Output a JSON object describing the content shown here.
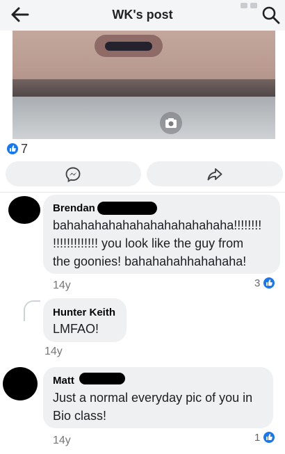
{
  "header": {
    "title": "WK's post"
  },
  "post": {
    "reaction_count": "7"
  },
  "comments": [
    {
      "author": "Brendan",
      "text": "bahahahahahahahahahahahaha!!!!!!!!\n!!!!!!!!!!!!! you look like the guy from\nthe goonies! bahahahahhahahaha!",
      "time": "14y",
      "reaction_count": "3"
    },
    {
      "author": "Hunter Keith",
      "text": "LMFAO!",
      "time": "14y"
    },
    {
      "author": "Matt",
      "text": "Just a normal everyday pic of you in\nBio class!",
      "time": "14y",
      "reaction_count": "1"
    }
  ],
  "colors": {
    "accent": "#1877f2",
    "bubble": "#eef0f2",
    "header_bg": "#f4f5f6"
  },
  "icons": [
    "back-arrow-icon",
    "search-icon",
    "camera-icon",
    "like-icon",
    "messenger-icon",
    "share-icon"
  ]
}
